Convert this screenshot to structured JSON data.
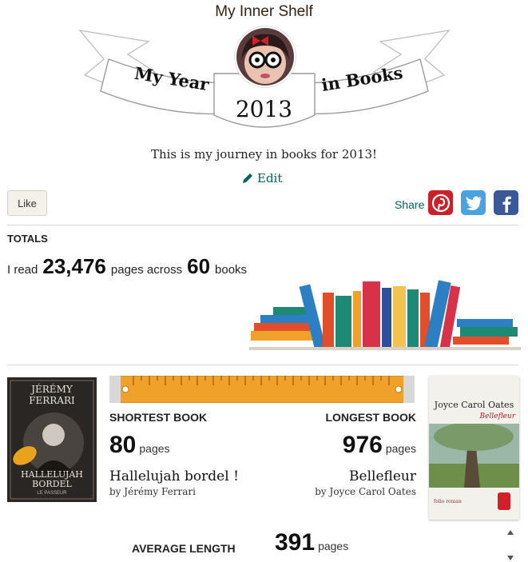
{
  "header": {
    "shelf_title": "My Inner Shelf",
    "banner_left": "My Year",
    "banner_right": "in Books",
    "year": "2013",
    "journey_text": "This is my journey in books for 2013!",
    "edit_label": "Edit"
  },
  "social": {
    "like_label": "Like",
    "share_label": "Share",
    "icons": [
      "pinterest-icon",
      "twitter-icon",
      "facebook-icon"
    ],
    "colors": {
      "pinterest": "#cb2027",
      "twitter": "#4aa3df",
      "facebook": "#3b5998"
    }
  },
  "totals": {
    "heading": "TOTALS",
    "prefix": "I read",
    "pages": "23,476",
    "middle": "pages across",
    "books": "60",
    "suffix": "books"
  },
  "shortest": {
    "heading": "SHORTEST BOOK",
    "pages": "80",
    "unit": "pages",
    "title": "Hallelujah bordel !",
    "by_prefix": "by",
    "author": "Jérémy Ferrari",
    "cover_text": {
      "author": "JÉRÉMY FERRARI",
      "title": "HALLELUJAH BORDEL",
      "publisher": "LE PASSEUR"
    }
  },
  "longest": {
    "heading": "LONGEST BOOK",
    "pages": "976",
    "unit": "pages",
    "title": "Bellefleur",
    "by_prefix": "by",
    "author": "Joyce Carol Oates",
    "cover_text": {
      "author": "Joyce Carol Oates",
      "title": "Bellefleur",
      "subtitle": "folio roman"
    }
  },
  "average": {
    "heading": "AVERAGE LENGTH",
    "pages": "391",
    "unit": "pages"
  },
  "theme": {
    "accent": "#00635d",
    "ruler": "#f0a12a"
  }
}
